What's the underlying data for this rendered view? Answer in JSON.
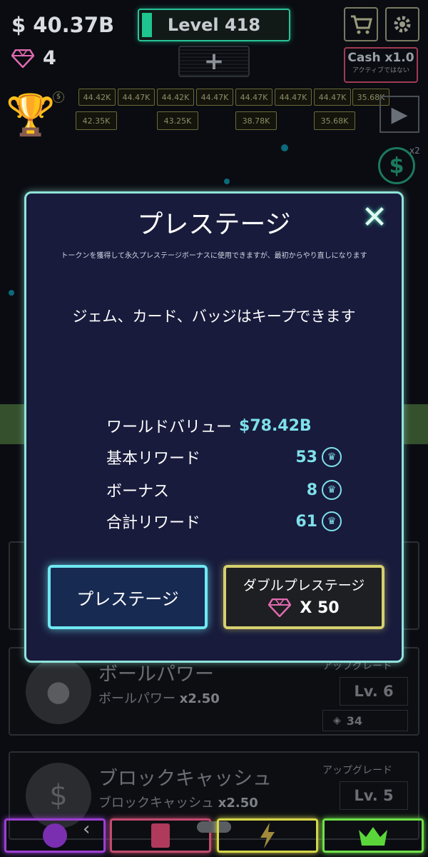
{
  "hud": {
    "money": "$ 40.37B",
    "gems": "4",
    "level": "Level 418",
    "level_progress": 0.07,
    "plus": "+",
    "cart_icon": "cart-icon",
    "settings_icon": "gear-icon",
    "cash_title": "Cash x1.0",
    "cash_sub": "アクティブではない"
  },
  "field": {
    "tiles_top": [
      "44.42K",
      "44.47K",
      "44.42K",
      "44.47K",
      "44.47K",
      "44.47K",
      "44.47K",
      "35.68K"
    ],
    "tiles_bottom": [
      "42.35K",
      "43.25K",
      "38.78K",
      "35.68K"
    ],
    "x2": "x2"
  },
  "cards": [
    {
      "title": "ボールパワー",
      "sub_name": "ボールパワー",
      "mult": "x2.50",
      "upgrade_label": "アップグレード",
      "level": "Lv. 6",
      "cost": "34"
    },
    {
      "title": "ブロックキャッシュ",
      "sub_name": "ブロックキャッシュ",
      "mult": "x2.50",
      "upgrade_label": "アップグレード",
      "level": "Lv. 5",
      "cost": ""
    }
  ],
  "modal": {
    "title": "プレステージ",
    "description": "トークンを獲得して永久プレステージボーナスに使用できますが、最初からやり直しになります",
    "keep_note": "ジェム、カード、バッジはキープできます",
    "stats": [
      {
        "label": "ワールドバリュー",
        "value": "$78.42B"
      },
      {
        "label": "基本リワード",
        "value": "53"
      },
      {
        "label": "ボーナス",
        "value": "8"
      },
      {
        "label": "合計リワード",
        "value": "61"
      }
    ],
    "prestige_button": "プレステージ",
    "double_button": "ダブルプレステージ",
    "double_cost": "X 50"
  },
  "nav": [
    {
      "icon": "ball-icon",
      "color": "#9b3fd0"
    },
    {
      "icon": "card-icon",
      "color": "#c24b6e"
    },
    {
      "icon": "lightning-icon",
      "color": "#d6d64a"
    },
    {
      "icon": "crown-icon",
      "color": "#6fe04a"
    }
  ]
}
